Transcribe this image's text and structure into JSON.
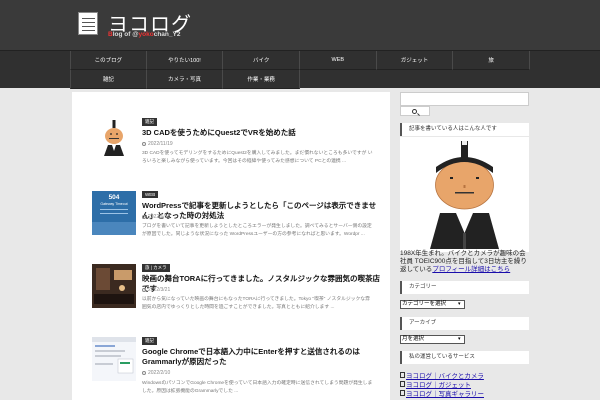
{
  "header": {
    "title": "ヨコログ",
    "subtitle_prefix": "Blog of @",
    "subtitle_handle_red": "yokochan_Y2",
    "subtitle_b": "B",
    "subtitle_log": "log of @",
    "subtitle_red": "yoko",
    "subtitle_rest": "chan_Y2"
  },
  "nav": {
    "row1": [
      "このブログ",
      "やりたい100!",
      "バイク",
      "WEB",
      "ガジェット",
      "旅"
    ],
    "row2": [
      "雑記",
      "カメラ・写真",
      "作業・業務"
    ]
  },
  "entries": [
    {
      "tag": "雑記",
      "title": "3D CADを使うためにQuest2でVRを始めた話",
      "date": "2022/11/19",
      "excerpt": "3D CADを使ってモデリングをするためにQuest2を購入してみました。まだ慣れないところも多いですが いろいろと楽しみながら使っています。今回はその経緯や使ってみた感想について PCとの連携 ..."
    },
    {
      "tag": "WEB",
      "title": "WordPressで記事を更新しようとしたら「このページは表示できません」となった時の対処法",
      "date": "2022/6/16",
      "excerpt": "ブログを書いていて記事を更新しようとしたところエラーが発生しました。調べてみるとサーバー側の設定が原因でした。同じような状況になった WordPressユーザーの方の参考になればと思います。Wordpr ..."
    },
    {
      "tag": "旅 | カメラ",
      "title": "映画の舞台TORAに行ってきました。ノスタルジックな雰囲気の喫茶店です",
      "date": "2022/3/21",
      "excerpt": "以前から気になっていた映画の舞台にもなったTORAに行ってきました。Tokyo \"喫茶\" ノスタルジックな雰囲気の店内でゆっくりとした時間を過ごすことができました。写真とともに紹介します ..."
    },
    {
      "tag": "雑記",
      "title": "Google Chromeで日本語入力中にEnterを押すと送信されるのはGrammarlyが原因だった",
      "date": "2022/2/10",
      "excerpt": "WindowsのパソコンでGoogle Chromeを使っていて日本語入力の確定時に送信されてしまう問題が発生しました。原因は拡張機能のGrammarlyでした ..."
    }
  ],
  "thumb2": {
    "line1": "504",
    "line2": "Gateway Timeout"
  },
  "sidebar": {
    "profile_head": "記事を書いている人はこんな人です",
    "profile_text": "198X年生まれ。バイクとカメラが趣味の会社員 TOEIC900点を目指して3日坊主を繰り返している",
    "profile_link": "プロフィール詳細はこちら",
    "category_head": "カテゴリー",
    "category_select": "カテゴリーを選択",
    "archive_head": "アーカイブ",
    "archive_select": "月を選択",
    "service_head": "私の運営しているサービス",
    "services": [
      "ヨコログ｜バイクとカメラ",
      "ヨコログ｜ガジェット",
      "ヨコログ｜写真ギャラリー"
    ]
  },
  "colors": {
    "header_bg": "#3a3a3a",
    "nav_bg": "#303030",
    "page_bg": "#e8e8e8",
    "link": "#1a0dab",
    "tag_bg": "#333333"
  }
}
